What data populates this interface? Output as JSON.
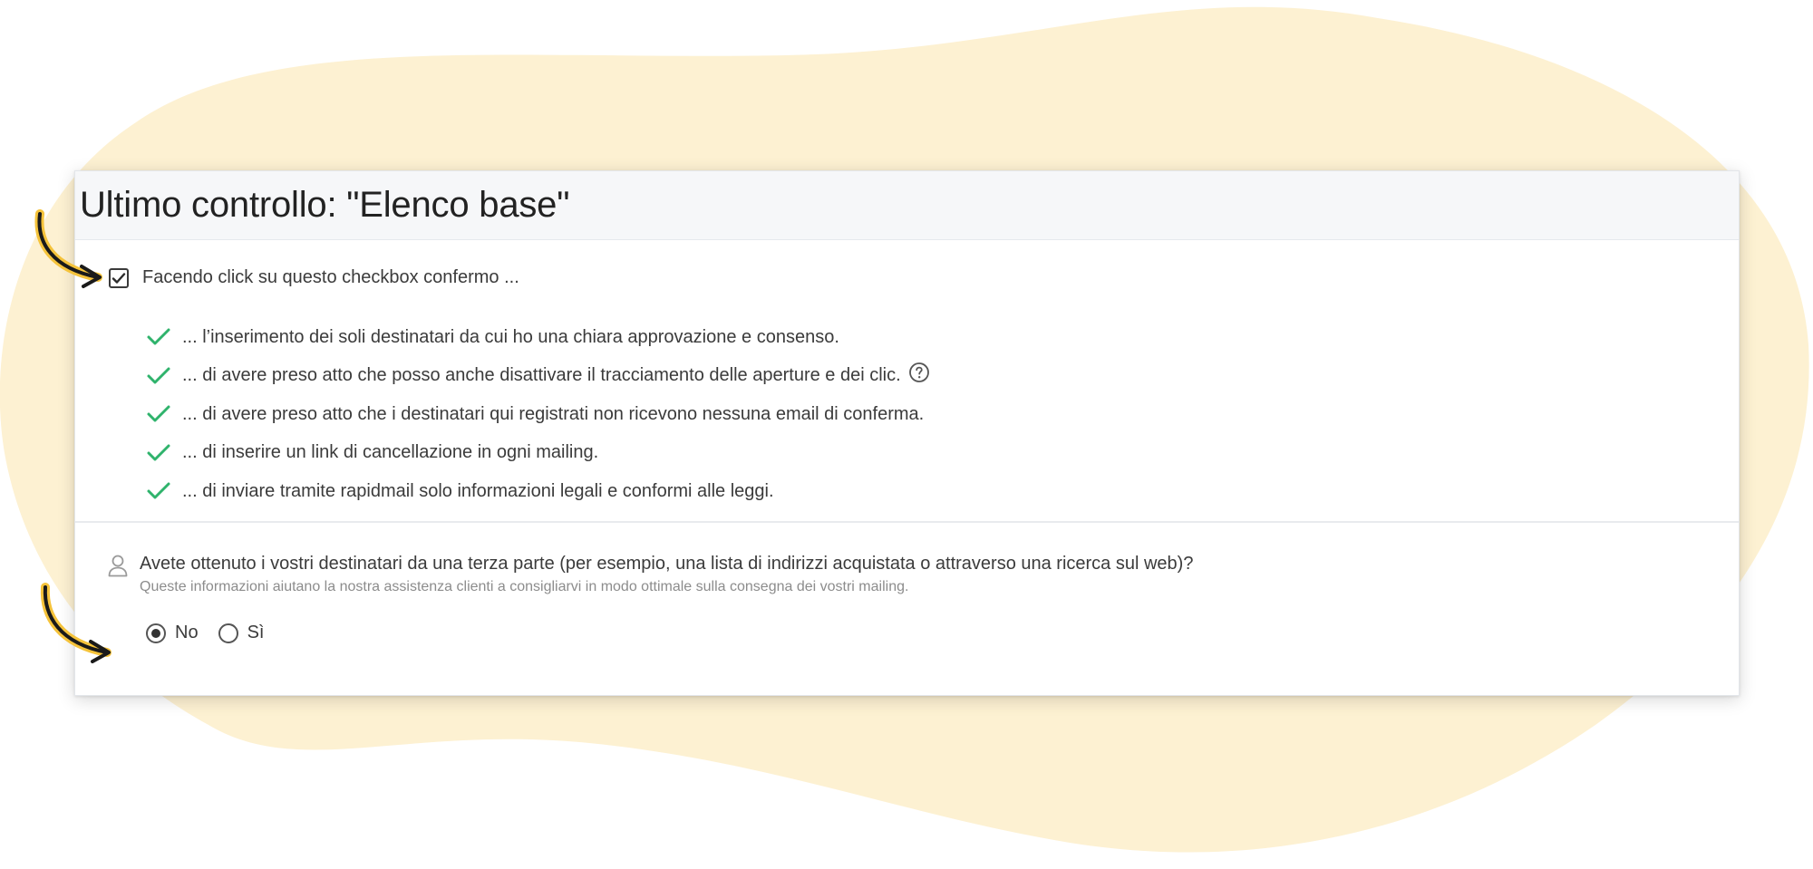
{
  "colors": {
    "background_blob": "#fdf1d2",
    "check_green": "#2fb36c",
    "arrow_yellow": "#f5c33b",
    "arrow_black": "#1a1a1a"
  },
  "card": {
    "title": "Ultimo controllo: \"Elenco base\""
  },
  "confirmation": {
    "checked": true,
    "label": "Facendo click su questo checkbox confermo ...",
    "items": [
      {
        "text": "... l’inserimento dei soli destinatari da cui ho una chiara approvazione e consenso."
      },
      {
        "text": "... di avere preso atto che posso anche disattivare il tracciamento delle aperture e dei clic.",
        "help_icon": "question-circle-icon"
      },
      {
        "text": "... di avere preso atto che i destinatari qui registrati non ricevono nessuna email di conferma."
      },
      {
        "text": "... di inserire un link di cancellazione in ogni mailing."
      },
      {
        "text": "... di inviare tramite rapidmail solo informazioni legali e conformi alle leggi."
      }
    ]
  },
  "third_party_question": {
    "icon": "person-icon",
    "title": "Avete ottenuto i vostri destinatari da una terza parte (per esempio, una lista di indirizzi acquistata o attraverso una ricerca sul web)?",
    "subtitle": "Queste informazioni aiutano la nostra assistenza clienti a consigliarvi in modo ottimale sulla consegna dei vostri mailing.",
    "options": [
      {
        "label": "No",
        "selected": true
      },
      {
        "label": "Sì",
        "selected": false
      }
    ]
  }
}
